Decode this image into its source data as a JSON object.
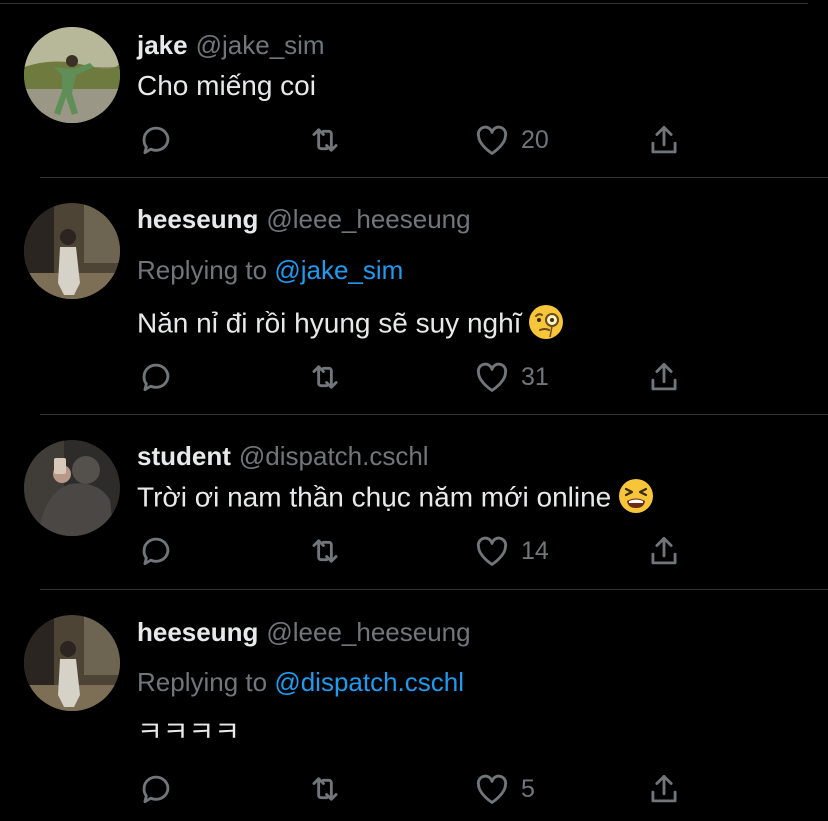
{
  "colors": {
    "background": "#000000",
    "primary_text": "#e7e9ea",
    "secondary_text": "#71767b",
    "mention": "#1d9bf0",
    "divider": "#2f3336"
  },
  "icons": {
    "reply": "reply-bubble-icon",
    "retweet": "retweet-icon",
    "like": "heart-icon",
    "share": "share-upload-icon"
  },
  "tweets": [
    {
      "name": "jake",
      "handle": "@jake_sim",
      "replying_prefix": "",
      "replying_to": "",
      "text": "Cho miếng coi",
      "emoji": "",
      "likes": "20"
    },
    {
      "name": "heeseung",
      "handle": "@leee_heeseung",
      "replying_prefix": "Replying to",
      "replying_to": "@jake_sim",
      "text": "Năn nỉ đi rồi hyung sẽ suy nghĩ",
      "emoji": "face-with-monocle",
      "likes": "31"
    },
    {
      "name": "student",
      "handle": "@dispatch.cschl",
      "replying_prefix": "",
      "replying_to": "",
      "text": "Trời ơi nam thần chục năm mới online",
      "emoji": "tired-face",
      "likes": "14"
    },
    {
      "name": "heeseung",
      "handle": "@leee_heeseung",
      "replying_prefix": "Replying to",
      "replying_to": "@dispatch.cschl",
      "text": "ㅋㅋㅋㅋ",
      "emoji": "",
      "likes": "5"
    }
  ]
}
